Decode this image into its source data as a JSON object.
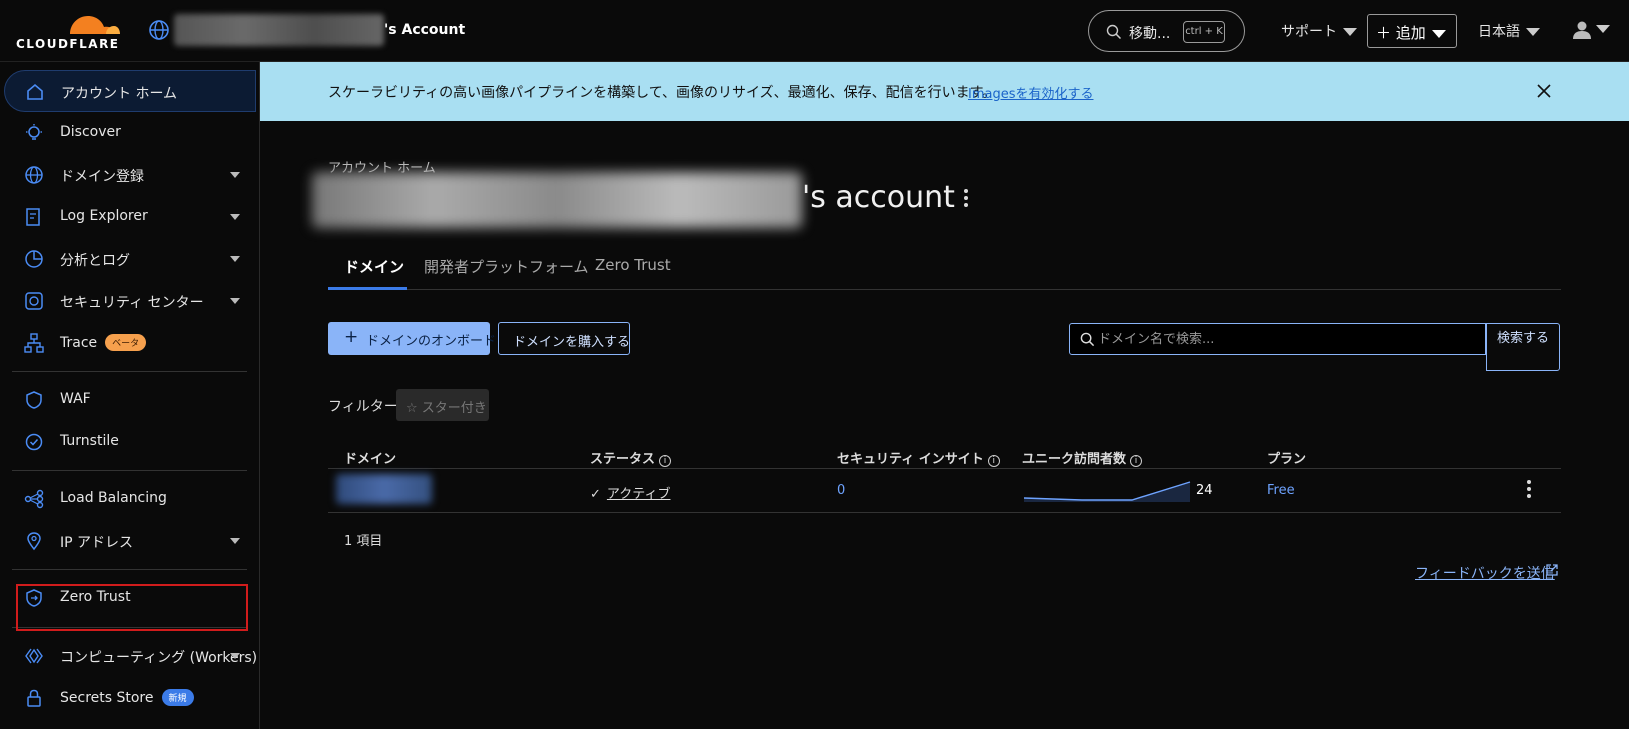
{
  "header": {
    "logo_text": "CLOUDFLARE",
    "account_suffix": "'s Account",
    "search_label": "移動...",
    "search_shortcut": "ctrl + K",
    "support_label": "サポート",
    "add_label": "追加",
    "language_label": "日本語"
  },
  "sidebar": {
    "items": [
      {
        "label": "アカウント ホーム"
      },
      {
        "label": "Discover"
      },
      {
        "label": "ドメイン登録"
      },
      {
        "label": "Log Explorer"
      },
      {
        "label": "分析とログ"
      },
      {
        "label": "セキュリティ センター"
      },
      {
        "label": "Trace",
        "badge": "ベータ"
      },
      {
        "label": "WAF"
      },
      {
        "label": "Turnstile"
      },
      {
        "label": "Load Balancing"
      },
      {
        "label": "IP アドレス"
      },
      {
        "label": "Zero Trust"
      },
      {
        "label": "コンピューティング (Workers)"
      },
      {
        "label": "Secrets Store",
        "badge": "新規"
      }
    ]
  },
  "banner": {
    "text": "スケーラビリティの高い画像パイプラインを構築して、画像のリサイズ、最適化、保存、配信を行います。",
    "link": "Imagesを有効化する"
  },
  "main": {
    "breadcrumb": "アカウント ホーム",
    "title_suffix": "'s account",
    "tabs": [
      {
        "label": "ドメイン"
      },
      {
        "label": "開発者プラットフォーム"
      },
      {
        "label": "Zero Trust"
      }
    ],
    "onboard_button": "ドメインのオンボード",
    "buy_button": "ドメインを購入する",
    "search_placeholder": "ドメイン名で検索...",
    "search_button": "検索する",
    "filter_label": "フィルター:",
    "filter_chip": "スター付き",
    "table": {
      "headers": [
        "ドメイン",
        "ステータス",
        "セキュリティ インサイト",
        "ユニーク訪問者数",
        "プラン"
      ],
      "rows": [
        {
          "status": "アクティブ",
          "security": "0",
          "visitors": "24",
          "plan": "Free"
        }
      ]
    },
    "item_count": "1 項目",
    "feedback_link": "フィードバックを送信"
  },
  "colors": {
    "accent": "#3b7be8",
    "banner_bg": "#a9dff2",
    "highlight": "#d11c1c"
  }
}
